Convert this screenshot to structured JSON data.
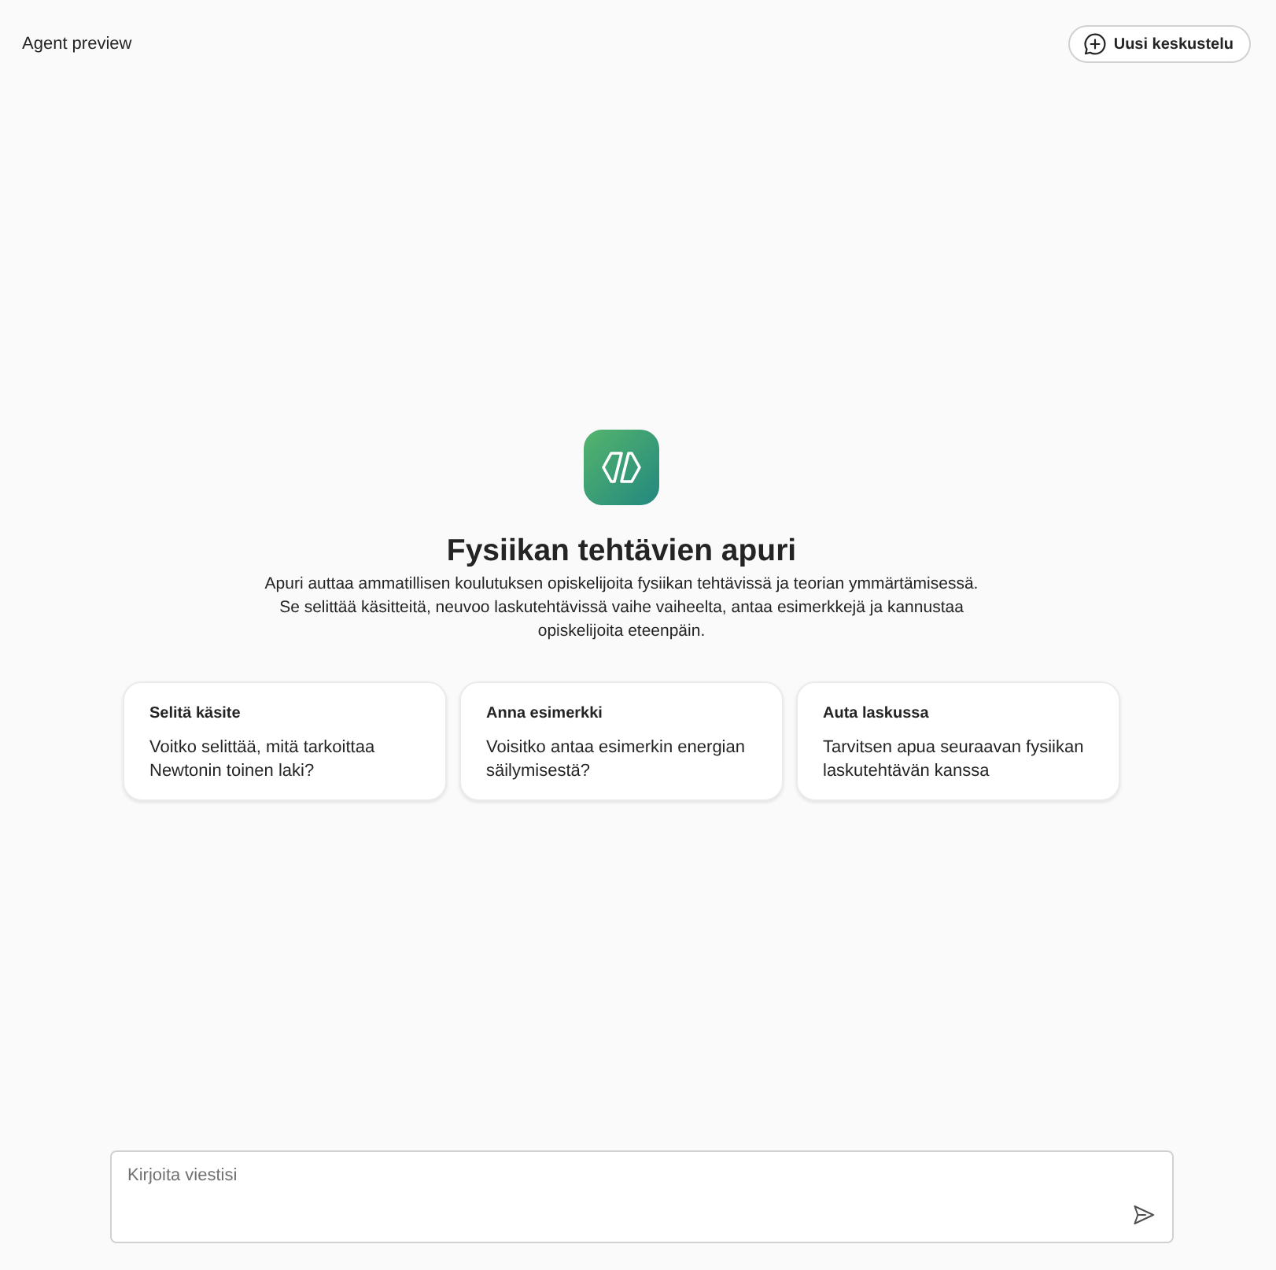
{
  "header": {
    "title": "Agent preview",
    "new_chat_button": {
      "label": "Uusi keskustelu"
    }
  },
  "agent": {
    "name": "Fysiikan tehtävien apuri",
    "description": "Apuri auttaa ammatillisen koulutuksen opiskelijoita fysiikan tehtävissä ja teorian ymmärtämisessä. Se selittää käsitteitä, neuvoo laskutehtävissä vaihe vaiheelta, antaa esimerkkejä ja kannustaa opiskelijoita eteenpäin."
  },
  "suggestions": [
    {
      "title": "Selitä käsite",
      "prompt": "Voitko selittää, mitä tarkoittaa Newtonin toinen laki?"
    },
    {
      "title": "Anna esimerkki",
      "prompt": "Voisitko antaa esimerkin energian säilymisestä?"
    },
    {
      "title": "Auta laskussa",
      "prompt": "Tarvitsen apua seuraavan fysiikan laskutehtävän kanssa"
    }
  ],
  "composer": {
    "placeholder": "Kirjoita viestisi"
  }
}
